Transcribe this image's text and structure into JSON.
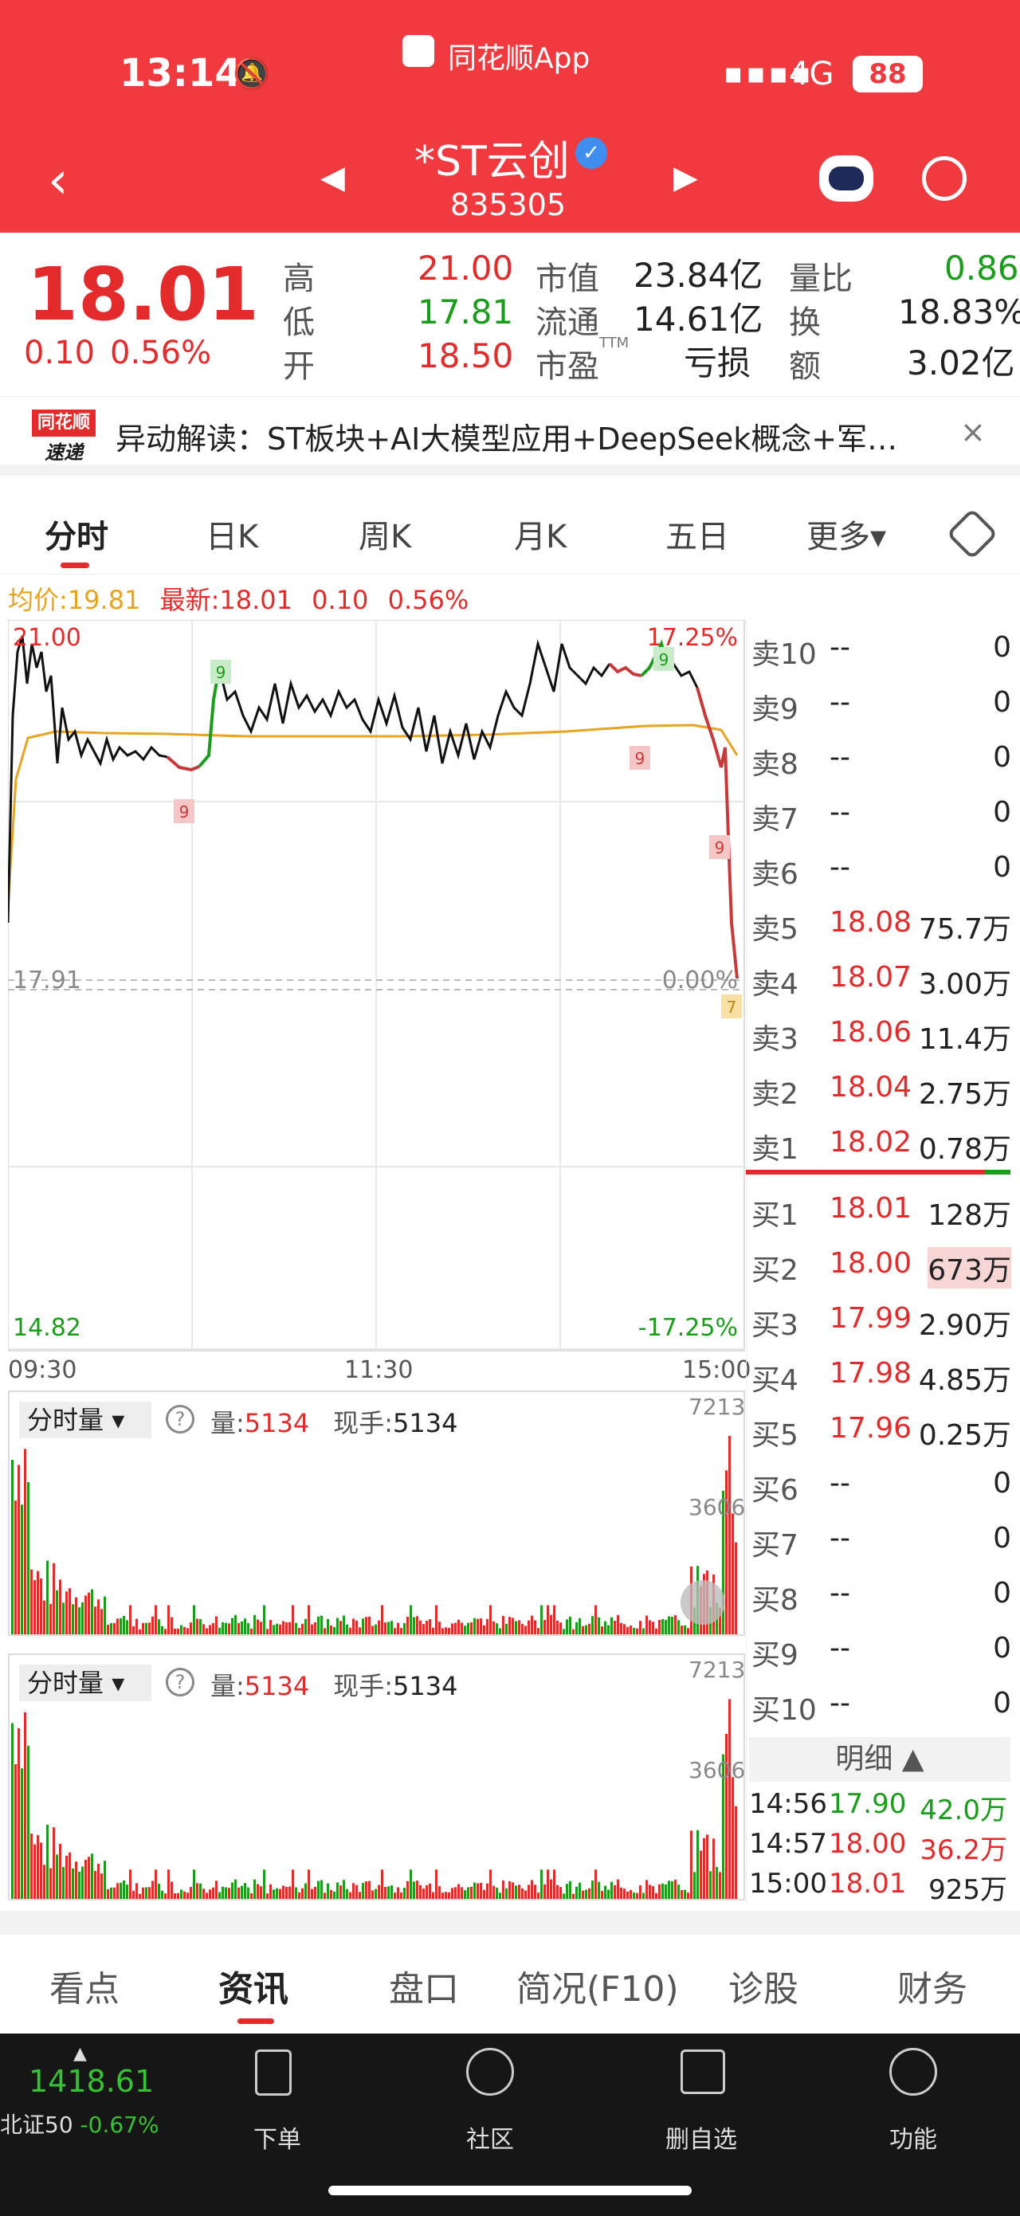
{
  "status": {
    "time": "13:14",
    "app": "同花顺App",
    "network": "4G",
    "battery": "88"
  },
  "stock": {
    "name": "*ST云创",
    "code": "835305"
  },
  "quote": {
    "price": "18.01",
    "change": "0.10",
    "change_pct": "0.56%",
    "high_label": "高",
    "high": "21.00",
    "low_label": "低",
    "low": "17.81",
    "open_label": "开",
    "open": "18.50",
    "mcap_label": "市值",
    "mcap": "23.84亿",
    "float_label": "流通",
    "float": "14.61亿",
    "pe_label": "市盈",
    "pe_sup": "TTM",
    "pe": "亏损",
    "vr_label": "量比",
    "vr": "0.86",
    "turn_label": "换",
    "turn": "18.83%",
    "amt_label": "额",
    "amt": "3.02亿"
  },
  "announce": {
    "logo_top": "同花顺",
    "logo_bottom": "速递",
    "text": "异动解读：ST板块+AI大模型应用+DeepSeek概念+军…",
    "close": "×"
  },
  "tabs": [
    "分时",
    "日K",
    "周K",
    "月K",
    "五日",
    "更多▾"
  ],
  "chart": {
    "avg_label": "均价:",
    "avg": "19.81",
    "latest_label": "最新:",
    "latest": "18.01",
    "chg": "0.10",
    "pct": "0.56%",
    "y_top": "21.00",
    "y_mid": "17.91",
    "y_bot": "14.82",
    "p_top": "17.25%",
    "p_mid": "0.00%",
    "p_bot": "-17.25%",
    "t0": "09:30",
    "t1": "11:30",
    "t2": "15:00",
    "vol_selector": "分时量",
    "vol_label": "量:",
    "vol": "5134",
    "hand_label": "现手:",
    "hand": "5134",
    "vol_max": "7213",
    "vol_mid": "3606"
  },
  "book": {
    "asks": [
      {
        "l": "卖10",
        "p": "--",
        "v": "0"
      },
      {
        "l": "卖9",
        "p": "--",
        "v": "0"
      },
      {
        "l": "卖8",
        "p": "--",
        "v": "0"
      },
      {
        "l": "卖7",
        "p": "--",
        "v": "0"
      },
      {
        "l": "卖6",
        "p": "--",
        "v": "0"
      },
      {
        "l": "卖5",
        "p": "18.08",
        "v": "75.7万"
      },
      {
        "l": "卖4",
        "p": "18.07",
        "v": "3.00万"
      },
      {
        "l": "卖3",
        "p": "18.06",
        "v": "11.4万"
      },
      {
        "l": "卖2",
        "p": "18.04",
        "v": "2.75万"
      },
      {
        "l": "卖1",
        "p": "18.02",
        "v": "0.78万"
      }
    ],
    "bids": [
      {
        "l": "买1",
        "p": "18.01",
        "v": "128万"
      },
      {
        "l": "买2",
        "p": "18.00",
        "v": "673万"
      },
      {
        "l": "买3",
        "p": "17.99",
        "v": "2.90万"
      },
      {
        "l": "买4",
        "p": "17.98",
        "v": "4.85万"
      },
      {
        "l": "买5",
        "p": "17.96",
        "v": "0.25万"
      },
      {
        "l": "买6",
        "p": "--",
        "v": "0"
      },
      {
        "l": "买7",
        "p": "--",
        "v": "0"
      },
      {
        "l": "买8",
        "p": "--",
        "v": "0"
      },
      {
        "l": "买9",
        "p": "--",
        "v": "0"
      },
      {
        "l": "买10",
        "p": "--",
        "v": "0"
      }
    ],
    "detail_label": "明细",
    "ticks": [
      {
        "t": "14:56",
        "p": "17.90",
        "v": "42.0万"
      },
      {
        "t": "14:57",
        "p": "18.00",
        "v": "36.2万"
      },
      {
        "t": "15:00",
        "p": "18.01",
        "v": "925万"
      }
    ]
  },
  "bottom_tabs": [
    "看点",
    "资讯",
    "盘口",
    "简况(F10)",
    "诊股",
    "财务"
  ],
  "nav": {
    "index_value": "1418.61",
    "index_name": "北证50",
    "index_pct": "-0.67%",
    "items": [
      "下单",
      "社区",
      "删自选",
      "功能"
    ]
  },
  "colors": {
    "red": "#f13a3f",
    "up": "#e32b2b",
    "down": "#1a9d1a",
    "avg_line": "#e8a31f"
  }
}
